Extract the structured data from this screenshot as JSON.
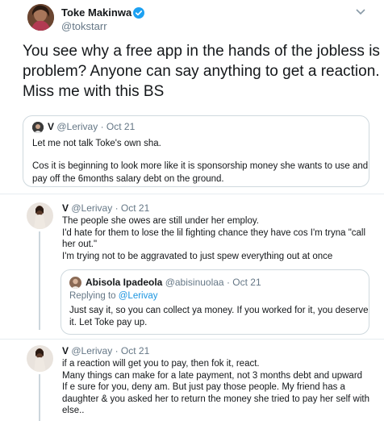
{
  "main_tweet": {
    "display_name": "Toke Makinwa",
    "handle": "@tokstarr",
    "text_lines": [
      "You see why a free app in the hands of the jobless is a",
      "problem? Anyone can say anything to get a reaction.",
      "Miss me with this BS"
    ]
  },
  "quoted_tweet": {
    "display_name": "V",
    "handle": "@Lerivay",
    "date": "Oct 21",
    "line1": "Let me not talk Toke's own sha.",
    "line2": "Cos it is beginning to look more like it is sponsorship money she wants to use and",
    "line3": "pay off the 6months salary debt on the ground."
  },
  "reply1": {
    "display_name": "V",
    "handle": "@Lerivay",
    "date": "Oct 21",
    "lines": [
      "The people she owes are still under her employ.",
      "I'd hate for them to lose the lil fighting chance they have cos I'm tryna \"call",
      "her out.\"",
      "I'm trying not to be aggravated to just spew  everything out at once"
    ],
    "quote": {
      "display_name": "Abisola Ipadeola",
      "handle": "@abisinuolaa",
      "date": "Oct 21",
      "replying_prefix": "Replying to",
      "replying_handle": "@Lerivay",
      "lines": [
        "Just say it, so you can collect ya money. If you worked for it, you deserve",
        "it. Let Toke pay up."
      ]
    }
  },
  "reply2": {
    "display_name": "V",
    "handle": "@Lerivay",
    "date": "Oct 21",
    "lines": [
      "if a reaction will get you to pay, then fok it, react.",
      "Many things can make for a late payment, not 3 months debt and upward",
      "If e sure for you, deny am. But just pay those people. My friend has a",
      "daughter & you asked her to return the money she tried to pay her self with",
      "else.."
    ]
  },
  "separator": "·",
  "colors": {
    "verified": "#1da1f2",
    "link": "#1b95e0",
    "muted": "#657786"
  }
}
